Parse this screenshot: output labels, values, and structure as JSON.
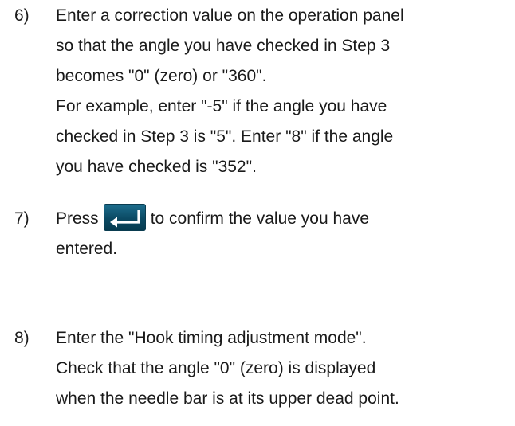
{
  "steps": [
    {
      "number": "6)",
      "lines": [
        "Enter a correction value on the operation panel",
        "so that the angle you have checked in Step 3",
        "becomes \"0\" (zero) or \"360\".",
        "For example, enter \"-5\" if the angle you have",
        "checked in Step 3 is \"5\". Enter \"8\" if the angle",
        "you have checked is \"352\"."
      ]
    },
    {
      "number": "7)",
      "before_icon": "Press",
      "icon": "enter-key-icon",
      "after_icon": "to confirm the value you have",
      "line2": "entered."
    },
    {
      "number": "8)",
      "lines": [
        "Enter the \"Hook timing adjustment mode\".",
        "Check that the angle \"0\" (zero) is displayed",
        "when the needle bar is at its upper dead point."
      ]
    }
  ],
  "colors": {
    "text": "#1a1a1a",
    "enter_key_bg": "#0b4a63",
    "enter_key_arrow": "#ffffff"
  }
}
